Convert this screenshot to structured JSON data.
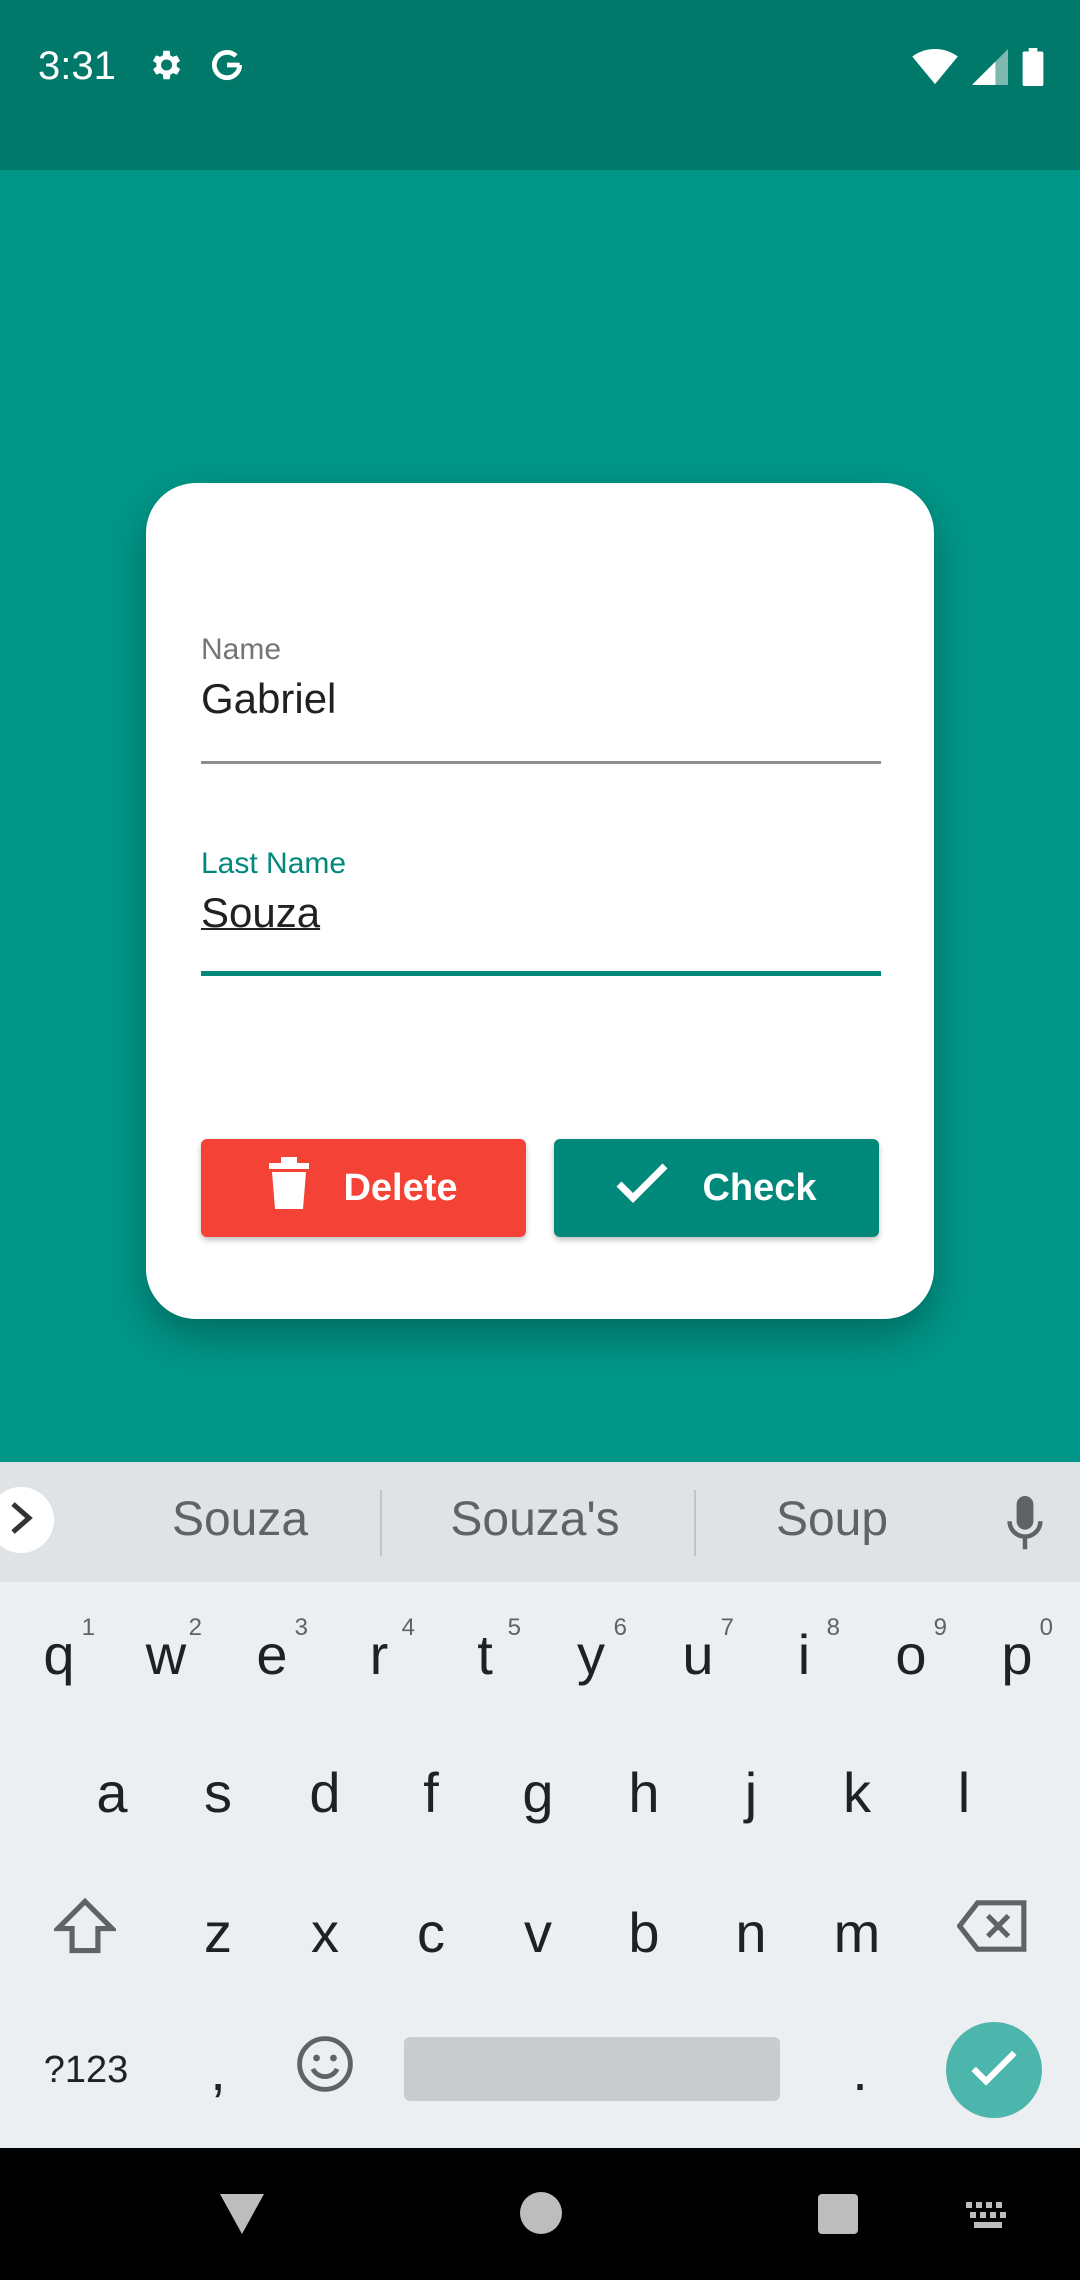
{
  "status_bar": {
    "time": "3:31",
    "left_icons": [
      "gear-icon",
      "google-icon"
    ],
    "right_icons": [
      "wifi-icon",
      "signal-icon",
      "battery-icon"
    ]
  },
  "form": {
    "name_label": "Name",
    "name_value": "Gabriel",
    "last_name_label": "Last Name",
    "last_name_value": "Souza"
  },
  "buttons": {
    "delete_label": "Delete",
    "check_label": "Check"
  },
  "colors": {
    "app_background": "#009688",
    "status_bar": "#00796b",
    "accent": "#00897b",
    "delete": "#f44336"
  },
  "keyboard": {
    "suggestions": [
      "Souza",
      "Souza's",
      "Soup"
    ],
    "row1": [
      "q",
      "w",
      "e",
      "r",
      "t",
      "y",
      "u",
      "i",
      "o",
      "p"
    ],
    "row1_hints": [
      "1",
      "2",
      "3",
      "4",
      "5",
      "6",
      "7",
      "8",
      "9",
      "0"
    ],
    "row2": [
      "a",
      "s",
      "d",
      "f",
      "g",
      "h",
      "j",
      "k",
      "l"
    ],
    "row3": [
      "z",
      "x",
      "c",
      "v",
      "b",
      "n",
      "m"
    ],
    "symbols_label": "?123",
    "comma": ",",
    "period": "."
  },
  "nav_bar": {
    "icons": [
      "back-icon",
      "home-icon",
      "recents-icon",
      "keyboard-switch-icon"
    ]
  }
}
